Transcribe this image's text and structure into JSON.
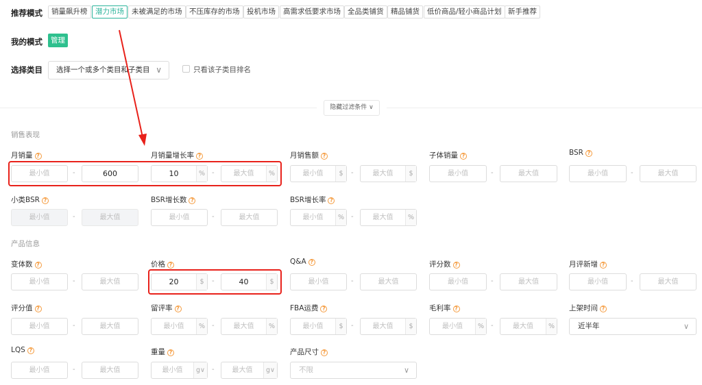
{
  "recommend": {
    "label": "推荐模式",
    "tags": [
      "销量飙升榜",
      "潜力市场",
      "未被满足的市场",
      "不压库存的市场",
      "投机市场",
      "高需求低要求市场",
      "全品类铺货",
      "精品铺货",
      "低价商品/轻小商品计划",
      "新手推荐"
    ],
    "active_index": 1
  },
  "my_mode": {
    "label": "我的模式",
    "manage": "管理"
  },
  "category": {
    "label": "选择类目",
    "select_placeholder": "选择一个或多个类目和子类目",
    "checkbox_label": "只看该子类目排名"
  },
  "hide_filters": "隐藏过滤条件",
  "min_ph": "最小值",
  "max_ph": "最大值",
  "sections": {
    "sales": "销售表现",
    "product": "产品信息"
  },
  "fields": {
    "monthly_sales": {
      "label": "月销量",
      "max": "600"
    },
    "monthly_sales_growth": {
      "label": "月销量增长率",
      "min": "10",
      "unit": "%"
    },
    "monthly_revenue": {
      "label": "月销售额",
      "unit": "$"
    },
    "child_sales": {
      "label": "子体销量"
    },
    "bsr": {
      "label": "BSR"
    },
    "sub_bsr": {
      "label": "小类BSR"
    },
    "bsr_growth": {
      "label": "BSR增长数"
    },
    "bsr_growth_rate": {
      "label": "BSR增长率",
      "unit": "%"
    },
    "variants": {
      "label": "变体数"
    },
    "price": {
      "label": "价格",
      "min": "20",
      "max": "40",
      "unit": "$"
    },
    "qa": {
      "label": "Q&A"
    },
    "reviews": {
      "label": "评分数"
    },
    "monthly_new_reviews": {
      "label": "月评新增"
    },
    "rating": {
      "label": "评分值"
    },
    "review_rate": {
      "label": "留评率",
      "unit": "%"
    },
    "fba_fee": {
      "label": "FBA运费",
      "unit": "$"
    },
    "margin": {
      "label": "毛利率",
      "unit": "%"
    },
    "listing_time": {
      "label": "上架时间",
      "value": "近半年"
    },
    "lqs": {
      "label": "LQS"
    },
    "weight": {
      "label": "重量",
      "unit": "g∨"
    },
    "size": {
      "label": "产品尺寸",
      "value": "不限"
    }
  },
  "dash": "-",
  "q": "?",
  "chev": "∨",
  "colors": {
    "accent": "#2bb39a",
    "manage_bg": "#2ec08e",
    "highlight": "#e8211a",
    "help": "#f59a3c"
  }
}
